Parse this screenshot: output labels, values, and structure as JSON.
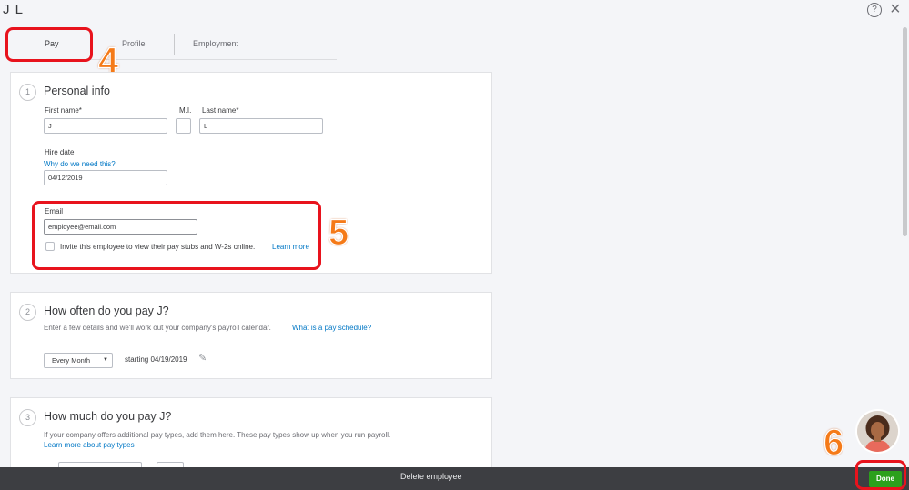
{
  "window": {
    "title": "J L",
    "help_icon": "question-circle-icon",
    "help_glyph": "?",
    "close_icon": "close-icon",
    "close_glyph": "×"
  },
  "tabs": [
    {
      "label": "Pay",
      "active": true
    },
    {
      "label": "Profile",
      "active": false
    },
    {
      "label": "Employment",
      "active": false
    }
  ],
  "annotations": {
    "step4": "4",
    "step5": "5",
    "step6": "6",
    "box_color": "#e8131d",
    "number_color": "#f57a18"
  },
  "personal_info": {
    "step": "1",
    "title": "Personal info",
    "first_name_label": "First name*",
    "first_name_value": "J",
    "mi_label": "M.I.",
    "mi_value": "",
    "last_name_label": "Last name*",
    "last_name_value": "L",
    "hire_date_label": "Hire date",
    "hire_date_link": "Why do we need this?",
    "hire_date_value": "04/12/2019",
    "email_label": "Email",
    "email_value": "employee@email.com",
    "invite_text": "Invite this employee to view their pay stubs and W-2s online.",
    "invite_checked": false,
    "learn_more": "Learn more"
  },
  "pay_schedule": {
    "step": "2",
    "title": "How often do you pay J?",
    "description": "Enter a few details and we'll work out your company's payroll calendar.",
    "link": "What is a pay schedule?",
    "frequency": "Every Month",
    "dropdown_icon": "caret-down-icon",
    "dropdown_glyph": "▼",
    "starting": "starting 04/19/2019",
    "edit_icon": "pencil-icon",
    "edit_glyph": "✎"
  },
  "pay_amount": {
    "step": "3",
    "title": "How much do you pay J?",
    "description": "If your company offers additional pay types, add them here. These pay types show up when you run payroll.",
    "link": "Learn more about pay types"
  },
  "footer": {
    "delete_label": "Delete employee",
    "done_label": "Done",
    "done_color": "#2ca01c"
  },
  "assistant": {
    "avatar_icon": "assistant-avatar-icon"
  }
}
